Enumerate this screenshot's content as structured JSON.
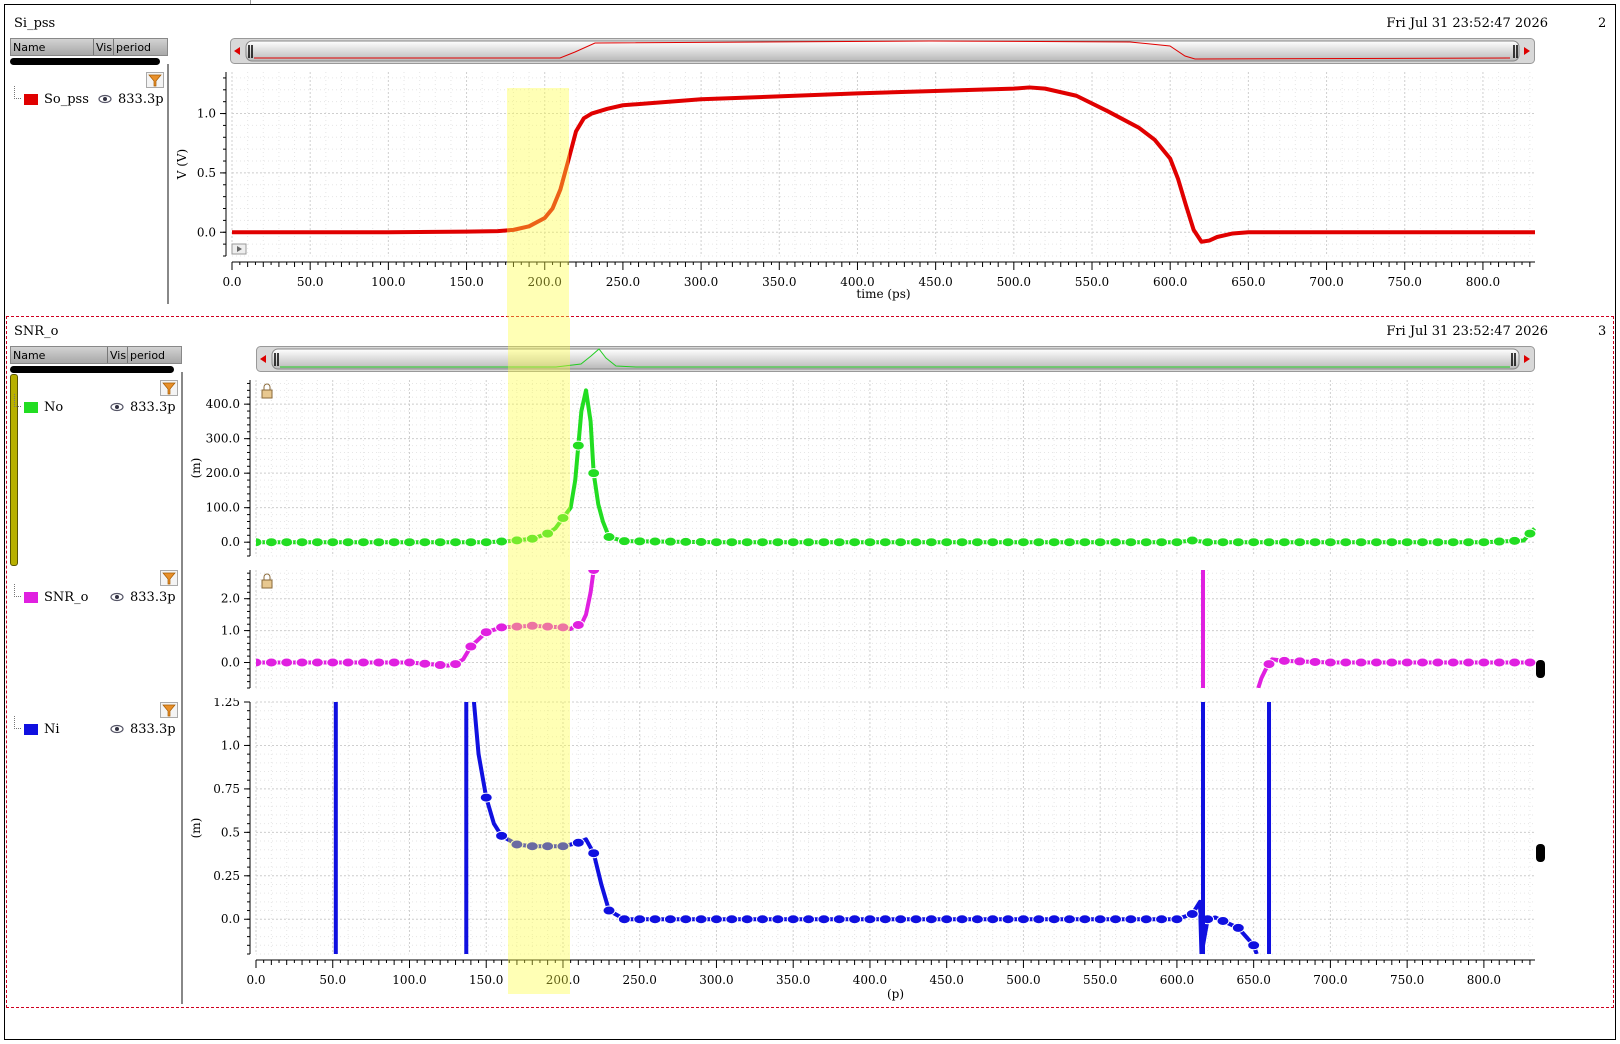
{
  "panels": [
    {
      "title": "Si_pss",
      "date": "Fri Jul 31 23:52:47 2026",
      "index": "2",
      "legend": {
        "col_name": "Name",
        "col_vis": "Vis",
        "col_period": "period"
      },
      "signals": [
        {
          "name": "So_pss",
          "color": "#e00000",
          "period": "833.3p"
        }
      ],
      "xaxis": {
        "label": "time (ps)",
        "ticks": [
          "0.0",
          "50.0",
          "100.0",
          "150.0",
          "200.0",
          "250.0",
          "300.0",
          "350.0",
          "400.0",
          "450.0",
          "500.0",
          "550.0",
          "600.0",
          "650.0",
          "700.0",
          "750.0",
          "800.0"
        ]
      },
      "strips": [
        {
          "ylabel": "V (V)",
          "yticks": [
            "1.0",
            "0.5",
            "0.0"
          ]
        }
      ]
    },
    {
      "title": "SNR_o",
      "date": "Fri Jul 31 23:52:47 2026",
      "index": "3",
      "legend": {
        "col_name": "Name",
        "col_vis": "Vis",
        "col_period": "period"
      },
      "signals": [
        {
          "name": "No",
          "color": "#22dd22",
          "period": "833.3p"
        },
        {
          "name": "SNR_o",
          "color": "#e020e0",
          "period": "833.3p"
        },
        {
          "name": "Ni",
          "color": "#1010e0",
          "period": "833.3p"
        }
      ],
      "xaxis": {
        "label": "(p)",
        "ticks": [
          "0.0",
          "50.0",
          "100.0",
          "150.0",
          "200.0",
          "250.0",
          "300.0",
          "350.0",
          "400.0",
          "450.0",
          "500.0",
          "550.0",
          "600.0",
          "650.0",
          "700.0",
          "750.0",
          "800.0"
        ]
      },
      "strips": [
        {
          "ylabel": "(m)",
          "yticks": [
            "400.0",
            "300.0",
            "200.0",
            "100.0",
            "0.0"
          ]
        },
        {
          "ylabel": "",
          "yticks": [
            "2.0",
            "1.0",
            "0.0"
          ]
        },
        {
          "ylabel": "(m)",
          "yticks": [
            "1.25",
            "1.0",
            "0.75",
            "0.5",
            "0.25",
            "0.0"
          ]
        }
      ]
    }
  ],
  "chart_data": [
    {
      "type": "line",
      "title": "Si_pss",
      "xlabel": "time (ps)",
      "ylabel": "V (V)",
      "xlim": [
        0,
        833.3
      ],
      "ylim": [
        -0.2,
        1.35
      ],
      "grid": true,
      "series": [
        {
          "name": "So_pss",
          "color": "#e00000",
          "x": [
            0,
            100,
            150,
            170,
            180,
            190,
            200,
            205,
            210,
            215,
            220,
            225,
            230,
            240,
            250,
            300,
            400,
            500,
            510,
            520,
            540,
            560,
            580,
            590,
            600,
            605,
            610,
            615,
            620,
            625,
            630,
            640,
            650,
            700,
            833.3
          ],
          "y": [
            0,
            0,
            0.005,
            0.01,
            0.02,
            0.05,
            0.12,
            0.2,
            0.36,
            0.6,
            0.85,
            0.96,
            1.0,
            1.04,
            1.07,
            1.12,
            1.17,
            1.21,
            1.22,
            1.21,
            1.15,
            1.02,
            0.88,
            0.78,
            0.62,
            0.45,
            0.23,
            0.02,
            -0.08,
            -0.07,
            -0.04,
            -0.01,
            0,
            0,
            0
          ]
        }
      ]
    },
    {
      "type": "line",
      "title": "No",
      "xlabel": "",
      "ylabel": "(m)",
      "xlim": [
        0,
        833.3
      ],
      "ylim": [
        -40,
        470
      ],
      "grid": true,
      "series": [
        {
          "name": "No",
          "color": "#22dd22",
          "x": [
            0,
            100,
            150,
            165,
            180,
            190,
            195,
            200,
            205,
            208,
            212,
            215,
            218,
            220,
            223,
            226,
            230,
            240,
            300,
            400,
            500,
            600,
            610,
            620,
            700,
            800,
            826,
            833
          ],
          "y": [
            0,
            0,
            0,
            3,
            10,
            25,
            40,
            70,
            100,
            180,
            380,
            440,
            350,
            200,
            110,
            60,
            15,
            3,
            0,
            0,
            0,
            0,
            5,
            0,
            0,
            0,
            5,
            40
          ]
        }
      ]
    },
    {
      "type": "line",
      "title": "SNR_o",
      "xlabel": "",
      "ylabel": "",
      "xlim": [
        0,
        833.3
      ],
      "ylim": [
        -0.8,
        2.9
      ],
      "grid": true,
      "series": [
        {
          "name": "SNR_o",
          "color": "#e020e0",
          "x": [
            0,
            100,
            125,
            130,
            135,
            140,
            150,
            160,
            180,
            200,
            205,
            208,
            212,
            215,
            218,
            220,
            222
          ],
          "y": [
            0,
            0,
            -0.1,
            -0.05,
            0.1,
            0.5,
            0.95,
            1.1,
            1.15,
            1.1,
            1.05,
            1.15,
            1.2,
            1.5,
            2.2,
            2.9,
            2.9
          ]
        },
        {
          "name": "SNR_o",
          "color": "#e020e0",
          "x": [
            653,
            655,
            658,
            662,
            670,
            700,
            800,
            833
          ],
          "y": [
            -0.8,
            -0.5,
            -0.2,
            0.1,
            0.05,
            0,
            0,
            0
          ]
        }
      ]
    },
    {
      "type": "line",
      "title": "Ni",
      "xlabel": "(p)",
      "ylabel": "(m)",
      "xlim": [
        0,
        833.3
      ],
      "ylim": [
        -0.2,
        1.25
      ],
      "grid": true,
      "series": [
        {
          "name": "Ni",
          "color": "#1010e0",
          "x": [
            142,
            145,
            150,
            155,
            160,
            170,
            180,
            200,
            210,
            215,
            220,
            225,
            230,
            240,
            300,
            400,
            500,
            600,
            610,
            615,
            616,
            620,
            625,
            640,
            645,
            650,
            652
          ],
          "y": [
            1.25,
            0.95,
            0.7,
            0.55,
            0.48,
            0.43,
            0.42,
            0.42,
            0.44,
            0.46,
            0.38,
            0.2,
            0.05,
            0,
            0,
            0,
            0,
            0,
            0.03,
            0.1,
            -0.2,
            0,
            0.01,
            -0.05,
            -0.1,
            -0.15,
            -0.2
          ]
        }
      ]
    }
  ]
}
